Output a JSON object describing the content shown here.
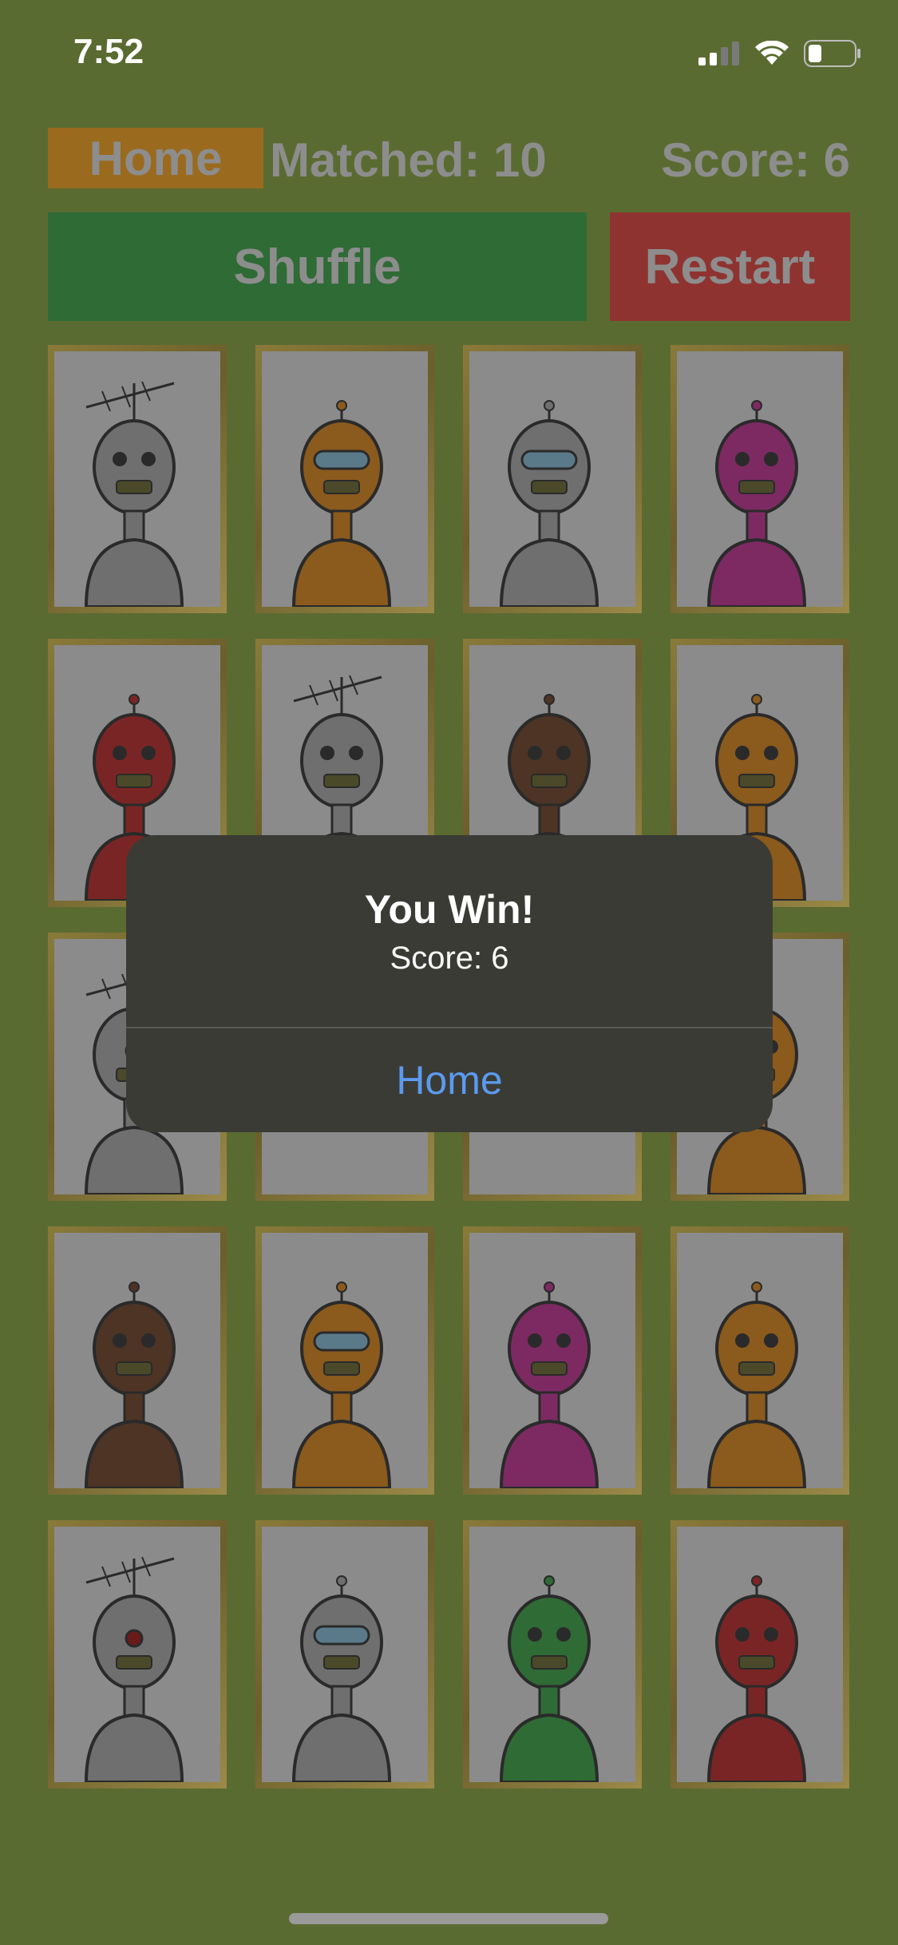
{
  "status_bar": {
    "time": "7:52"
  },
  "top_bar": {
    "home_label": "Home",
    "matched_text": "Matched: 10",
    "score_text": "Score: 6"
  },
  "actions": {
    "shuffle_label": "Shuffle",
    "restart_label": "Restart"
  },
  "cards": [
    {
      "robot": "gray-antenna-robot",
      "color": "#6f6f6f"
    },
    {
      "robot": "orange-visor-robot",
      "color": "#8b5a1d"
    },
    {
      "robot": "gray-dome-robot",
      "color": "#6f6f6f"
    },
    {
      "robot": "pink-robot",
      "color": "#7d2a63"
    },
    {
      "robot": "red-robot",
      "color": "#7a2525"
    },
    {
      "robot": "gray-antenna-robot",
      "color": "#6f6f6f"
    },
    {
      "robot": "brown-robot",
      "color": "#4d3425"
    },
    {
      "robot": "orange-bolt-robot",
      "color": "#8b5a1d"
    },
    {
      "robot": "gray-antenna-red-eye-robot",
      "color": "#6f6f6f"
    },
    {
      "robot": "hidden-card",
      "color": "#8b8b8b"
    },
    {
      "robot": "hidden-card",
      "color": "#8b8b8b"
    },
    {
      "robot": "orange-bolt-robot",
      "color": "#8b5a1d"
    },
    {
      "robot": "brown-robot",
      "color": "#4d3425"
    },
    {
      "robot": "orange-visor-robot",
      "color": "#8b5a1d"
    },
    {
      "robot": "pink-robot",
      "color": "#7d2a63"
    },
    {
      "robot": "orange-bolt-robot",
      "color": "#8b5a1d"
    },
    {
      "robot": "gray-antenna-red-eye-robot",
      "color": "#6f6f6f"
    },
    {
      "robot": "gray-dome-robot",
      "color": "#6f6f6f"
    },
    {
      "robot": "green-robot",
      "color": "#2f6b35"
    },
    {
      "robot": "red-robot",
      "color": "#7a2525"
    }
  ],
  "dialog": {
    "title": "You Win!",
    "message": "Score: 6",
    "button_label": "Home"
  }
}
